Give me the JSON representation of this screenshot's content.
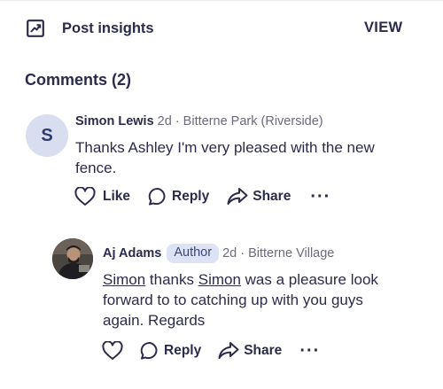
{
  "insights": {
    "icon": "trend-chart-icon",
    "label": "Post insights",
    "view_label": "VIEW"
  },
  "comments": {
    "title": "Comments (2)",
    "items": [
      {
        "avatar_letter": "S",
        "name": "Simon Lewis",
        "meta": " 2d · Bitterne Park (Riverside)",
        "text_lines": [
          "Thanks Ashley I'm very pleased with the new",
          "fence."
        ],
        "actions": {
          "like": "Like",
          "reply": "Reply",
          "share": "Share"
        }
      },
      {
        "name": "Aj Adams",
        "badge": "Author",
        "meta": "2d · Bitterne Village",
        "mention_1": "Simon",
        "text_mid": " thanks ",
        "mention_2": "Simon",
        "text_rest": " was a pleasure look",
        "text_lines": [
          "forward to to catching up with you guys",
          "again. Regards"
        ],
        "actions": {
          "reply": "Reply",
          "share": "Share"
        }
      }
    ]
  },
  "colors": {
    "text": "#2c2b4c",
    "muted": "#6b6a80",
    "avatar_bg": "#d8ddef",
    "badge_bg": "#dde3f4"
  }
}
